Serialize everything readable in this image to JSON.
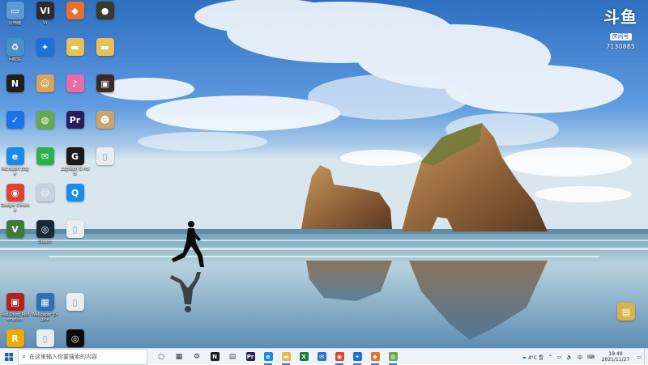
{
  "watermark": {
    "logo": "斗鱼",
    "sub": "房间号",
    "room_id": "7130885"
  },
  "desktop": {
    "icons": [
      {
        "label": "此电脑",
        "icon": "computer-icon",
        "glyph": "▭",
        "color": "#5b9bd5"
      },
      {
        "label": "VI",
        "icon": "vi-icon",
        "glyph": "VI",
        "color": "#2c2c2c"
      },
      {
        "label": "",
        "icon": "game-orange-icon",
        "glyph": "◆",
        "color": "#e8712b"
      },
      {
        "label": "",
        "icon": "game-dark-icon",
        "glyph": "●",
        "color": "#3a3a2c"
      },
      {
        "label": "回收站",
        "icon": "recycle-bin-icon",
        "glyph": "♻",
        "color": "#4a90c2"
      },
      {
        "label": "",
        "icon": "blue-app-icon",
        "glyph": "✦",
        "color": "#1e6fd9"
      },
      {
        "label": "",
        "icon": "folder-icon",
        "glyph": "▬",
        "color": "#e6c15a"
      },
      {
        "label": "",
        "icon": "folder-icon-2",
        "glyph": "▬",
        "color": "#e6c15a"
      },
      {
        "label": "",
        "icon": "notion-icon",
        "glyph": "N",
        "color": "#1f1f1f"
      },
      {
        "label": "",
        "icon": "anime-icon",
        "glyph": "☺",
        "color": "#d9a35b"
      },
      {
        "label": "",
        "icon": "pink-app-icon",
        "glyph": "♪",
        "color": "#e86ca8"
      },
      {
        "label": "",
        "icon": "game-cover-icon",
        "glyph": "▣",
        "color": "#3b2a2a"
      },
      {
        "label": "",
        "icon": "shield-icon",
        "glyph": "✓",
        "color": "#1a73e8"
      },
      {
        "label": "",
        "icon": "globe-icon",
        "glyph": "◍",
        "color": "#6aa84f"
      },
      {
        "label": "",
        "icon": "premiere-icon",
        "glyph": "Pr",
        "color": "#2a1b5c"
      },
      {
        "label": "",
        "icon": "character-icon",
        "glyph": "☻",
        "color": "#c9a56b"
      },
      {
        "label": "Microsoft Edge",
        "icon": "edge-icon",
        "glyph": "e",
        "color": "#1e88e5"
      },
      {
        "label": "",
        "icon": "wechat-icon",
        "glyph": "✉",
        "color": "#2bb24c"
      },
      {
        "label": "Logitech G HUB",
        "icon": "logitech-icon",
        "glyph": "G",
        "color": "#1a1a1a"
      },
      {
        "label": "",
        "icon": "document-icon",
        "glyph": "▯",
        "color": "#e9edf2"
      },
      {
        "label": "Google Chrome",
        "icon": "chrome-icon",
        "glyph": "◉",
        "color": "#db4437"
      },
      {
        "label": "",
        "icon": "anime-icon-2",
        "glyph": "☺",
        "color": "#c7d1e0"
      },
      {
        "label": "",
        "icon": "qq-icon",
        "glyph": "Q",
        "color": "#1b8ce8"
      },
      {
        "label": "",
        "icon": "empty-slot",
        "glyph": "",
        "color": "transparent"
      },
      {
        "label": "",
        "icon": "gta-icon",
        "glyph": "V",
        "color": "#3e7a3a"
      },
      {
        "label": "Steam",
        "icon": "steam-icon",
        "glyph": "◎",
        "color": "#1b2838"
      },
      {
        "label": "",
        "icon": "document-icon-2",
        "glyph": "▯",
        "color": "#e9edf2"
      },
      {
        "label": "",
        "icon": "empty-slot-2",
        "glyph": "",
        "color": "transparent"
      },
      {
        "label": "",
        "icon": "empty-slot-3",
        "glyph": "",
        "color": "transparent"
      },
      {
        "label": "",
        "icon": "empty-slot-4",
        "glyph": "",
        "color": "transparent"
      },
      {
        "label": "",
        "icon": "empty-slot-5",
        "glyph": "",
        "color": "transparent"
      },
      {
        "label": "",
        "icon": "empty-slot-6",
        "glyph": "",
        "color": "transparent"
      },
      {
        "label": "Red Dead Redemption",
        "icon": "rdr-icon",
        "glyph": "▣",
        "color": "#b32020"
      },
      {
        "label": "Wallpaper Engine",
        "icon": "wallpaper-engine-icon",
        "glyph": "▦",
        "color": "#2d6fb8"
      },
      {
        "label": "",
        "icon": "document-icon-3",
        "glyph": "▯",
        "color": "#e9edf2"
      },
      {
        "label": "",
        "icon": "empty-slot-7",
        "glyph": "",
        "color": "transparent"
      },
      {
        "label": "",
        "icon": "rockstar-icon",
        "glyph": "R",
        "color": "#f2a900"
      },
      {
        "label": "",
        "icon": "document-icon-4",
        "glyph": "▯",
        "color": "#e9edf2"
      },
      {
        "label": "",
        "icon": "spiral-app-icon",
        "glyph": "◎",
        "color": "#0b0b0b"
      },
      {
        "label": "",
        "icon": "empty-slot-8",
        "glyph": "",
        "color": "transparent"
      }
    ],
    "right_icon": {
      "label": "",
      "icon": "zip-file-icon",
      "glyph": "▤",
      "color": "#d7b34a"
    }
  },
  "taskbar": {
    "search_placeholder": "在这里输入你要搜索的内容",
    "apps": [
      {
        "icon": "task-view-icon",
        "glyph": "○",
        "color": "#333333",
        "active": false
      },
      {
        "icon": "widgets-icon",
        "glyph": "▦",
        "color": "#333333",
        "active": false
      },
      {
        "icon": "settings-icon",
        "glyph": "⚙",
        "color": "#333333",
        "active": false
      },
      {
        "icon": "notion-taskbar-icon",
        "glyph": "N",
        "color": "#1f1f1f",
        "active": false
      },
      {
        "icon": "calculator-icon",
        "glyph": "▤",
        "color": "#555555",
        "active": false
      },
      {
        "icon": "premiere-taskbar-icon",
        "glyph": "Pr",
        "color": "#2a1b5c",
        "active": false
      },
      {
        "icon": "edge-taskbar-icon",
        "glyph": "e",
        "color": "#1e88e5",
        "active": true
      },
      {
        "icon": "explorer-icon",
        "glyph": "▬",
        "color": "#e6b84a",
        "active": true
      },
      {
        "icon": "excel-icon",
        "glyph": "X",
        "color": "#1f7a44",
        "active": false
      },
      {
        "icon": "mail-icon",
        "glyph": "✉",
        "color": "#2a6fd6",
        "active": false
      },
      {
        "icon": "chrome-taskbar-icon",
        "glyph": "◉",
        "color": "#db4437",
        "active": true
      },
      {
        "icon": "blue-app-taskbar-icon",
        "glyph": "✦",
        "color": "#1e6fd9",
        "active": true
      },
      {
        "icon": "orange-app-taskbar-icon",
        "glyph": "◆",
        "color": "#e8712b",
        "active": true
      },
      {
        "icon": "globe-taskbar-icon",
        "glyph": "◍",
        "color": "#6aa84f",
        "active": true
      }
    ],
    "tray": {
      "weather": "4°C 雪",
      "language": "中",
      "time": "19:49",
      "date": "2021/11/27"
    }
  }
}
